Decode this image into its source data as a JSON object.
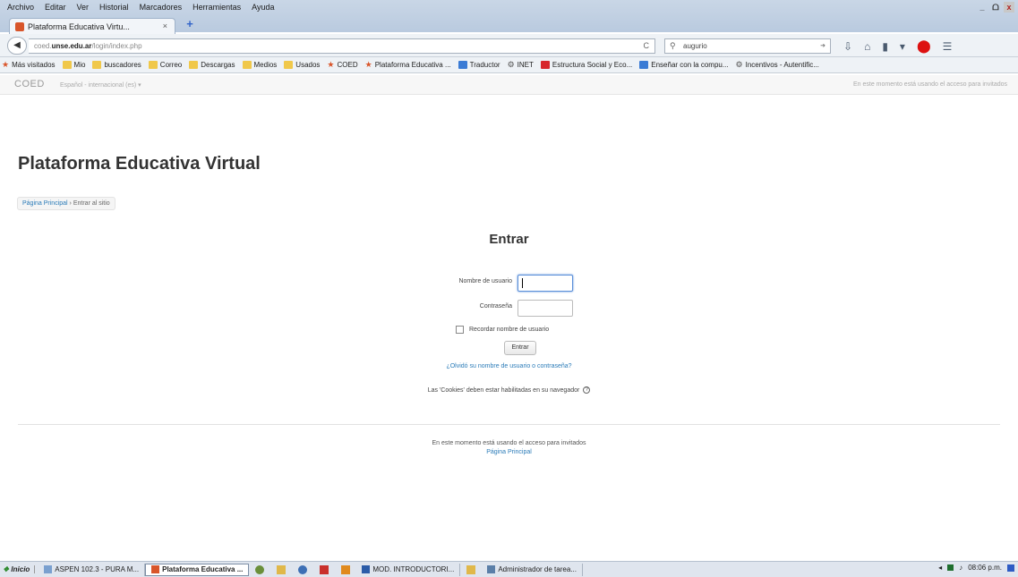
{
  "browser": {
    "menu": [
      "Archivo",
      "Editar",
      "Ver",
      "Historial",
      "Marcadores",
      "Herramientas",
      "Ayuda"
    ],
    "window_controls": [
      "_",
      "ᗝ",
      "x"
    ],
    "tab": {
      "title": "Plataforma Educativa Virtu...",
      "close": "×"
    },
    "new_tab": "+",
    "back": "◀",
    "url": {
      "prefix": "coed.",
      "host": "unse.edu.ar",
      "path": "/login/index.php"
    },
    "reload": "C",
    "search": {
      "value": "augurio"
    },
    "bookmarks": [
      {
        "label": "Más visitados",
        "icon": "star"
      },
      {
        "label": "Mio",
        "icon": "folder"
      },
      {
        "label": "buscadores",
        "icon": "folder"
      },
      {
        "label": "Correo",
        "icon": "folder"
      },
      {
        "label": "Descargas",
        "icon": "folder"
      },
      {
        "label": "Medios",
        "icon": "folder"
      },
      {
        "label": "Usados",
        "icon": "folder"
      },
      {
        "label": "COED",
        "icon": "star"
      },
      {
        "label": "Plataforma Educativa ...",
        "icon": "star"
      },
      {
        "label": "Traductor",
        "icon": "blue"
      },
      {
        "label": "INET",
        "icon": "grey"
      },
      {
        "label": "Estructura Social y Eco...",
        "icon": "red"
      },
      {
        "label": "Enseñar con la compu...",
        "icon": "blue"
      },
      {
        "label": "Incentivos - Autentific...",
        "icon": "grey"
      }
    ]
  },
  "site": {
    "brand": "COED",
    "language": "Español - internacional (es) ▾",
    "guest_note": "En este momento está usando el acceso para invitados"
  },
  "page": {
    "title": "Plataforma Educativa Virtual",
    "breadcrumb": {
      "home": "Página Principal",
      "sep": "›",
      "current": "Entrar al sitio"
    }
  },
  "login": {
    "heading": "Entrar",
    "username_label": "Nombre de usuario",
    "username_value": "",
    "password_label": "Contraseña",
    "password_value": "",
    "remember_label": "Recordar nombre de usuario",
    "submit_label": "Entrar",
    "forgot_link": "¿Olvidó su nombre de usuario o contraseña?",
    "cookies_note": "Las 'Cookies' deben estar habilitadas en su navegador",
    "help_icon": "?"
  },
  "footer": {
    "guest_note": "En este momento está usando el acceso para invitados",
    "home_link": "Página Principal"
  },
  "taskbar": {
    "start": "Inicio",
    "tasks": [
      {
        "label": "ASPEN 102.3 - PURA M...",
        "active": false
      },
      {
        "label": "Plataforma Educativa ...",
        "active": true
      },
      {
        "label": "MOD. INTRODUCTORI...",
        "active": false
      },
      {
        "label": "Administrador de tarea...",
        "active": false
      }
    ],
    "clock": "08:06 p.m."
  }
}
